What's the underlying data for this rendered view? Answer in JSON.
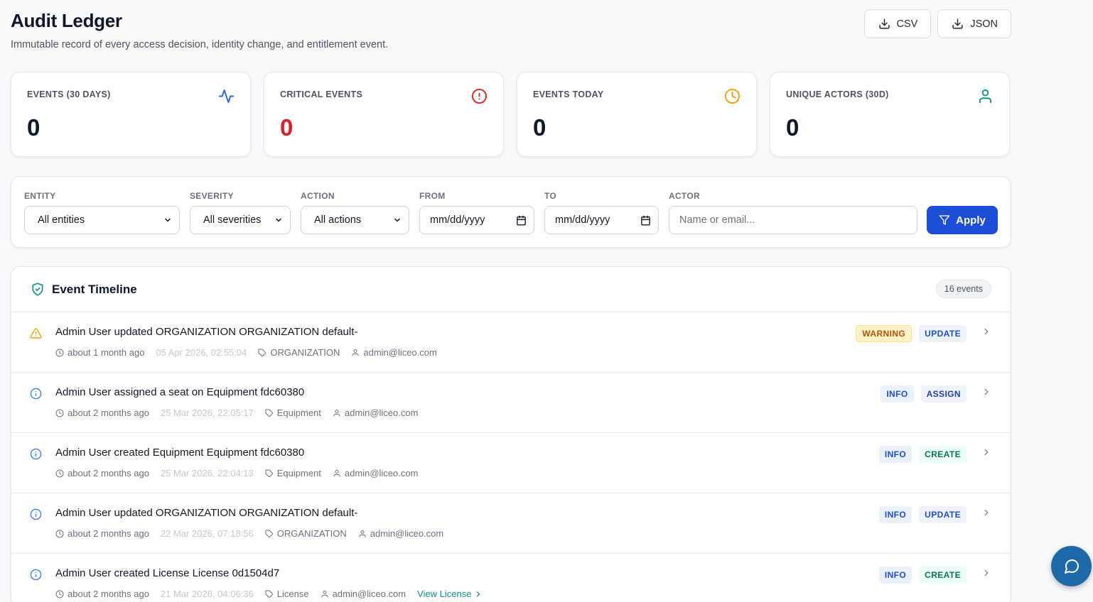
{
  "header": {
    "title": "Audit Ledger",
    "subtitle": "Immutable record of every access decision, identity change, and entitlement event.",
    "export_csv": "CSV",
    "export_json": "JSON"
  },
  "stats": [
    {
      "label": "EVENTS (30 DAYS)",
      "value": "0",
      "icon": "activity-icon",
      "color": "#2563eb"
    },
    {
      "label": "CRITICAL EVENTS",
      "value": "0",
      "icon": "alert-circle-icon",
      "color": "#dc2626"
    },
    {
      "label": "EVENTS TODAY",
      "value": "0",
      "icon": "clock-icon",
      "color": "#f59e0b"
    },
    {
      "label": "UNIQUE ACTORS (30D)",
      "value": "0",
      "icon": "user-icon",
      "color": "#0d9488"
    }
  ],
  "filters": {
    "entity": {
      "label": "ENTITY",
      "value": "All entities"
    },
    "severity": {
      "label": "SEVERITY",
      "value": "All severities"
    },
    "action": {
      "label": "ACTION",
      "value": "All actions"
    },
    "from": {
      "label": "FROM",
      "value": "mm/dd/yyyy"
    },
    "to": {
      "label": "TO",
      "value": "mm/dd/yyyy"
    },
    "actor": {
      "label": "ACTOR",
      "placeholder": "Name or email..."
    },
    "apply": "Apply"
  },
  "timeline": {
    "title": "Event Timeline",
    "count": "16 events",
    "events": [
      {
        "title": "Admin User updated ORGANIZATION ORGANIZATION default-",
        "relative": "about 1 month ago",
        "timestamp": "05 Apr 2026, 02:55:04",
        "entity": "ORGANIZATION",
        "actor": "admin@liceo.com",
        "severity": "WARNING",
        "action": "UPDATE",
        "link": ""
      },
      {
        "title": "Admin User assigned a seat on Equipment fdc60380",
        "relative": "about 2 months ago",
        "timestamp": "25 Mar 2026, 22:05:17",
        "entity": "Equipment",
        "actor": "admin@liceo.com",
        "severity": "INFO",
        "action": "ASSIGN",
        "link": ""
      },
      {
        "title": "Admin User created Equipment Equipment fdc60380",
        "relative": "about 2 months ago",
        "timestamp": "25 Mar 2026, 22:04:13",
        "entity": "Equipment",
        "actor": "admin@liceo.com",
        "severity": "INFO",
        "action": "CREATE",
        "link": ""
      },
      {
        "title": "Admin User updated ORGANIZATION ORGANIZATION default-",
        "relative": "about 2 months ago",
        "timestamp": "22 Mar 2026, 07:18:56",
        "entity": "ORGANIZATION",
        "actor": "admin@liceo.com",
        "severity": "INFO",
        "action": "UPDATE",
        "link": ""
      },
      {
        "title": "Admin User created License License 0d1504d7",
        "relative": "about 2 months ago",
        "timestamp": "21 Mar 2026, 04:06:36",
        "entity": "License",
        "actor": "admin@liceo.com",
        "severity": "INFO",
        "action": "CREATE",
        "link": "View License"
      }
    ]
  }
}
